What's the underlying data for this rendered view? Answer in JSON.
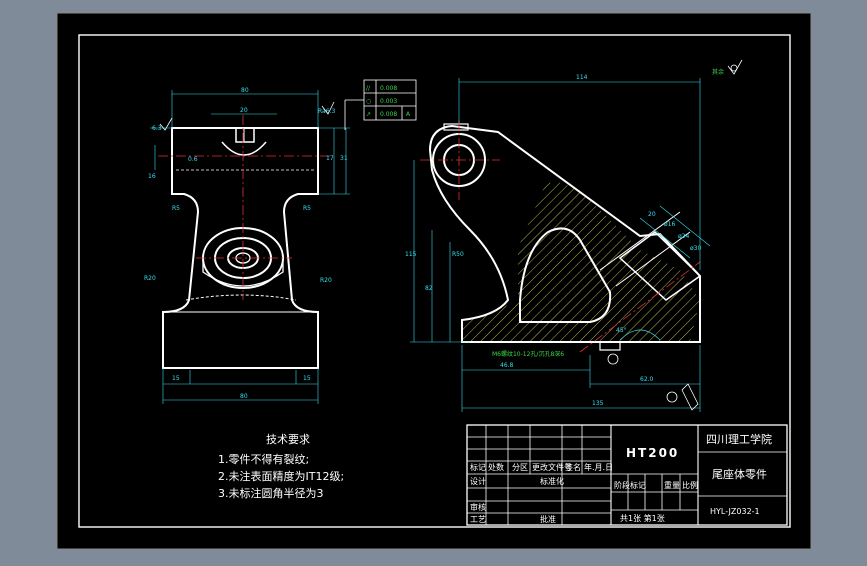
{
  "colors": {
    "background": "#7f8b99",
    "sheet": "#000000",
    "outline": "#ffffff",
    "dimension": "#35e0ef",
    "center_line": "#e03030",
    "hatch": "#e8e85a",
    "callout": "#3ed54a"
  },
  "front_view": {
    "dims": {
      "top_width": "80",
      "slot_width": "20",
      "base_width": "80",
      "foot_left": "15",
      "foot_right": "15",
      "bore_height": "16",
      "height_a": "17",
      "height_b": "31",
      "rough_left": "6.3",
      "radius_left": "R5",
      "radius_right": "R5",
      "fillet_left": "R20",
      "fillet_right": "R20",
      "center_mark": "0.6",
      "side_mark": "Ra6.3"
    }
  },
  "gdt": {
    "rows": [
      {
        "symbol": "//",
        "value": "0.008"
      },
      {
        "symbol": "○",
        "value": "0.003"
      },
      {
        "symbol": "↗",
        "value": "0.008",
        "datum": "A"
      }
    ]
  },
  "side_view": {
    "dims": {
      "overall_top": "114",
      "left_height": "115",
      "mid_height": "82",
      "inner_height": "R50",
      "bottom_a": "46.8",
      "bottom_b": "62.0",
      "bottom_overall": "135",
      "angle": "45°",
      "slant_a": "ø16",
      "slant_b": "ø24",
      "slant_c": "ø30",
      "slant_d": "20"
    },
    "note": "M6螺纹10-12孔/沉孔8深6",
    "roughness": "其余"
  },
  "notes": {
    "title": "技术要求",
    "items": [
      "1.零件不得有裂纹;",
      "2.未注表面精度为IT12级;",
      "3.未标注圆角半径为3"
    ]
  },
  "title_block": {
    "material": "HT200",
    "school": "四川理工学院",
    "part_name": "尾座体零件",
    "drawing_no": "HYL-JZ032-1",
    "row_labels": [
      "标记",
      "处数",
      "分区",
      "更改文件号",
      "签名",
      "年.月.日"
    ],
    "design": "设计",
    "standard": "标准化",
    "review": "审核",
    "process": "工艺",
    "approve": "批准",
    "stage_labels": [
      "阶段标记",
      "重量",
      "比例"
    ],
    "sheet_info": "共1张  第1张"
  }
}
